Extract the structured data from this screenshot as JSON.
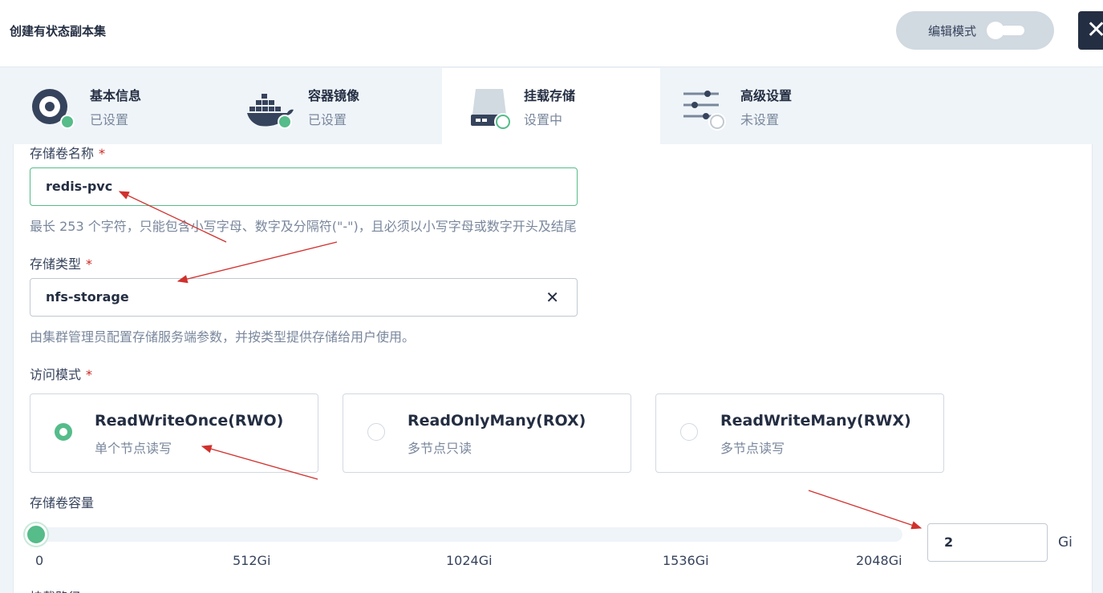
{
  "header": {
    "title": "创建有状态副本集",
    "edit_mode_label": "编辑模式",
    "close_glyph": "✕"
  },
  "steps": [
    {
      "title": "基本信息",
      "status": "已设置",
      "icon": "disk-icon",
      "state": "done"
    },
    {
      "title": "容器镜像",
      "status": "已设置",
      "icon": "docker-icon",
      "state": "done"
    },
    {
      "title": "挂载存储",
      "status": "设置中",
      "icon": "storage-icon",
      "state": "current"
    },
    {
      "title": "高级设置",
      "status": "未设置",
      "icon": "sliders-icon",
      "state": "todo"
    }
  ],
  "form": {
    "volume_name": {
      "label": "存储卷名称",
      "required": "*",
      "value": "redis-pvc",
      "hint": "最长 253 个字符，只能包含小写字母、数字及分隔符(\"-\")，且必须以小写字母或数字开头及结尾"
    },
    "storage_class": {
      "label": "存储类型",
      "required": "*",
      "value": "nfs-storage",
      "clear_glyph": "✕",
      "hint": "由集群管理员配置存储服务端参数，并按类型提供存储给用户使用。"
    },
    "access_mode": {
      "label": "访问模式",
      "required": "*",
      "options": [
        {
          "title": "ReadWriteOnce(RWO)",
          "desc": "单个节点读写",
          "selected": true
        },
        {
          "title": "ReadOnlyMany(ROX)",
          "desc": "多节点只读",
          "selected": false
        },
        {
          "title": "ReadWriteMany(RWX)",
          "desc": "多节点读写",
          "selected": false
        }
      ]
    },
    "capacity": {
      "label": "存储卷容量",
      "ticks": [
        "0",
        "512Gi",
        "1024Gi",
        "1536Gi",
        "2048Gi"
      ],
      "value": "2",
      "unit": "Gi",
      "slider_min": 0,
      "slider_max": 2048,
      "slider_value": 2
    },
    "next_label_partial": "挂载路径"
  },
  "colors": {
    "accent": "#55bc8a",
    "required": "#ca2621",
    "annotation": "#d0312d"
  }
}
